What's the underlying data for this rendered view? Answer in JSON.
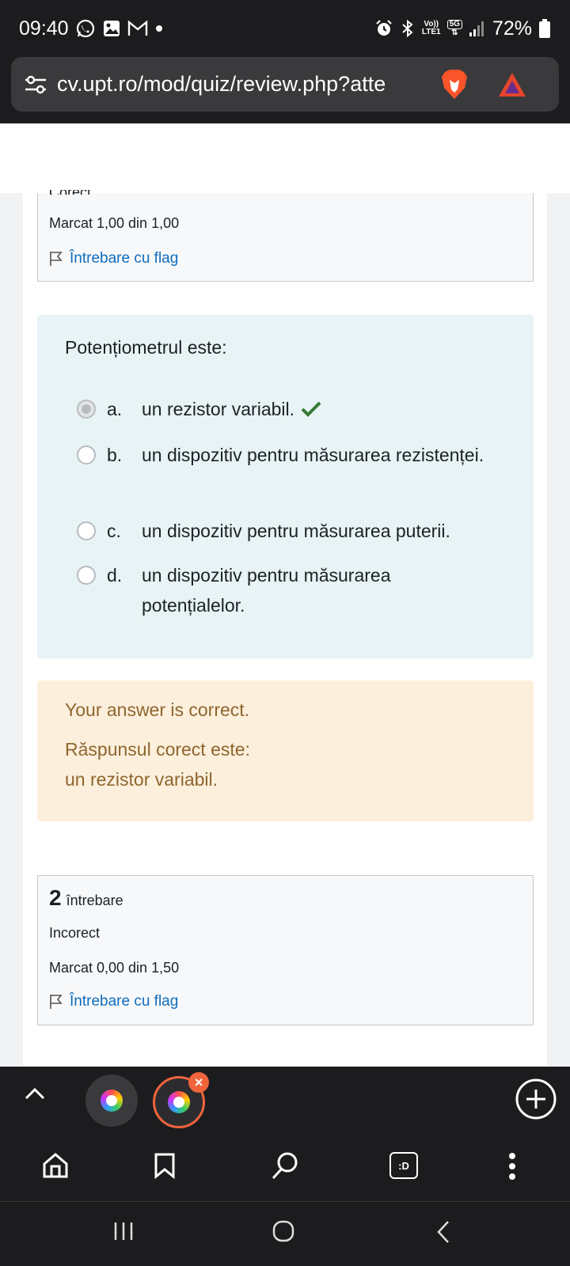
{
  "status_bar": {
    "time": "09:40",
    "network_top": "Vo))",
    "network_bottom": "LTE1",
    "net_type": "5G",
    "battery": "72%"
  },
  "url_bar": {
    "url": "cv.upt.ro/mod/quiz/review.php?atte"
  },
  "prev_question": {
    "status_cut": "Corect",
    "mark": "Marcat 1,00 din 1,00",
    "flag_label": "Întrebare cu flag"
  },
  "question": {
    "text": "Potențiometrul este:",
    "answers": [
      {
        "letter": "a.",
        "text": "un rezistor variabil.",
        "selected": true,
        "correct": true
      },
      {
        "letter": "b.",
        "text": "un dispozitiv pentru măsurarea rezistenței.",
        "selected": false
      },
      {
        "letter": "c.",
        "text": "un dispozitiv pentru măsurarea puterii.",
        "selected": false
      },
      {
        "letter": "d.",
        "text": "un dispozitiv pentru măsurarea potențialelor.",
        "selected": false
      }
    ]
  },
  "feedback": {
    "line1": "Your answer is correct.",
    "line2": "Răspunsul corect este:",
    "line3": "un rezistor variabil."
  },
  "question2": {
    "number": "2",
    "word": "întrebare",
    "status": "Incorect",
    "mark": "Marcat 0,00 din 1,50",
    "flag_label": "Întrebare cu flag"
  },
  "toolbar": {
    "reader_label": ":D"
  },
  "colors": {
    "link": "#0f6cbf",
    "feedback_text": "#8e662e",
    "feedback_bg": "#fcefdc",
    "question_bg": "#e7f3f5",
    "check_green": "#357a32",
    "tab_accent": "#f0643c"
  }
}
